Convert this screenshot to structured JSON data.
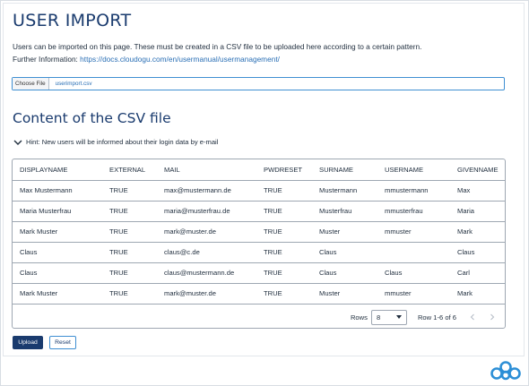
{
  "header": {
    "title": "USER IMPORT"
  },
  "intro": {
    "line1": "Users can be imported on this page. These must be created in a CSV file to be uploaded here according to a certain pattern.",
    "line2_prefix": "Further Information: ",
    "link": "https://docs.cloudogu.com/en/usermanual/usermanagement/"
  },
  "file_input": {
    "button_label": "Choose File",
    "file_name": "userimport.csv"
  },
  "csv_section": {
    "title": "Content of the CSV file",
    "hint": "Hint: New users will be informed about their login data by e-mail"
  },
  "table": {
    "headers": [
      "DISPLAYNAME",
      "EXTERNAL",
      "MAIL",
      "PWDRESET",
      "SURNAME",
      "USERNAME",
      "GIVENNAME"
    ],
    "rows": [
      [
        "Max Mustermann",
        "TRUE",
        "max@mustermann.de",
        "TRUE",
        "Mustermann",
        "mmustermann",
        "Max"
      ],
      [
        "Maria Musterfrau",
        "TRUE",
        "maria@musterfrau.de",
        "TRUE",
        "Musterfrau",
        "mmusterfrau",
        "Maria"
      ],
      [
        "Mark Muster",
        "TRUE",
        "mark@muster.de",
        "TRUE",
        "Muster",
        "mmuster",
        "Mark"
      ],
      [
        "Claus",
        "TRUE",
        "claus@c.de",
        "TRUE",
        "Claus",
        "",
        "Claus"
      ],
      [
        "Claus",
        "TRUE",
        "claus@mustermann.de",
        "TRUE",
        "Claus",
        "Claus",
        "Carl"
      ],
      [
        "Mark Muster",
        "TRUE",
        "mark@muster.de",
        "TRUE",
        "Muster",
        "mmuster",
        "Mark"
      ]
    ]
  },
  "pagination": {
    "rows_label": "Rows",
    "rows_value": "8",
    "range_text": "Row 1-6 of 6",
    "prev_icon": "chevron-left-icon",
    "next_icon": "chevron-right-icon"
  },
  "actions": {
    "upload_label": "Upload",
    "reset_label": "Reset"
  },
  "colors": {
    "primary": "#1a3b6e",
    "link": "#2a6fb5",
    "logo": "#2d8fd6"
  }
}
